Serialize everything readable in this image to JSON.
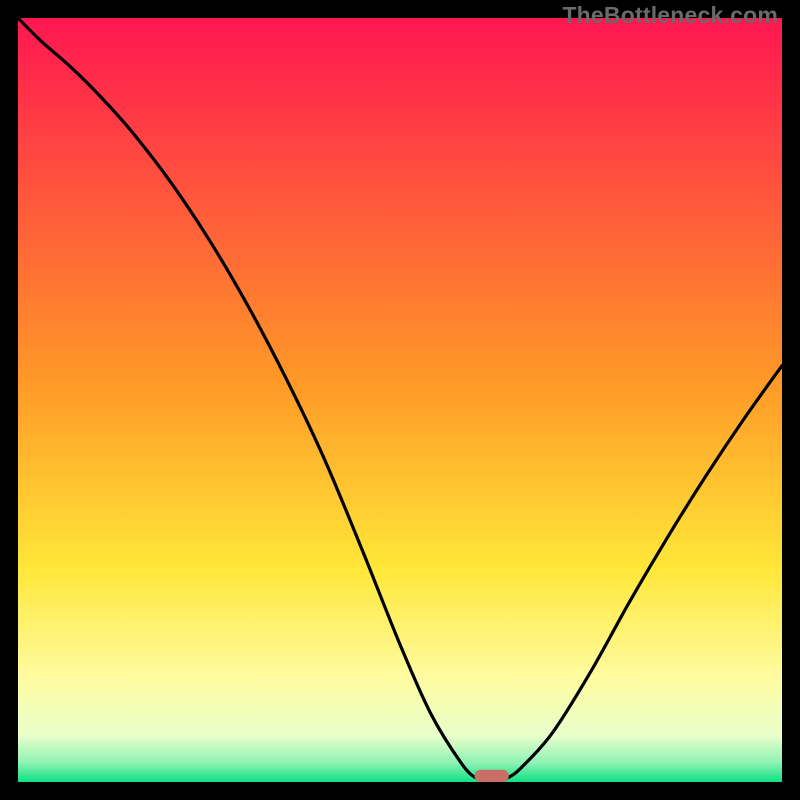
{
  "watermark": "TheBottleneck.com",
  "chart_data": {
    "type": "line",
    "title": "",
    "xlabel": "",
    "ylabel": "",
    "xlim": [
      0,
      100
    ],
    "ylim": [
      0,
      100
    ],
    "grid": false,
    "legend": false,
    "series": [
      {
        "name": "bottleneck-curve",
        "x": [
          0,
          3,
          7,
          11,
          15,
          20,
          25,
          30,
          35,
          40,
          45,
          50,
          54,
          58,
          60,
          62,
          64,
          66,
          70,
          75,
          80,
          85,
          90,
          95,
          100
        ],
        "y": [
          100,
          97,
          93.5,
          89.5,
          85,
          78.5,
          71,
          62.5,
          53,
          42.5,
          30.5,
          18,
          9,
          2.5,
          0.5,
          0,
          0.5,
          2,
          6.5,
          14.5,
          23.5,
          32,
          40,
          47.5,
          54.5
        ]
      }
    ],
    "marker": {
      "name": "optimal-point",
      "x": 62,
      "y": 0,
      "w": 4.5,
      "h": 1.6,
      "color": "#ca6f68"
    },
    "gradient_stops": [
      {
        "pct": 0,
        "color": "#ff1650"
      },
      {
        "pct": 48,
        "color": "#ff9a27"
      },
      {
        "pct": 72,
        "color": "#ffe738"
      },
      {
        "pct": 86,
        "color": "#fffb9e"
      },
      {
        "pct": 94,
        "color": "#e8ffca"
      },
      {
        "pct": 97.5,
        "color": "#8cf3b3"
      },
      {
        "pct": 100,
        "color": "#10e083"
      }
    ]
  }
}
